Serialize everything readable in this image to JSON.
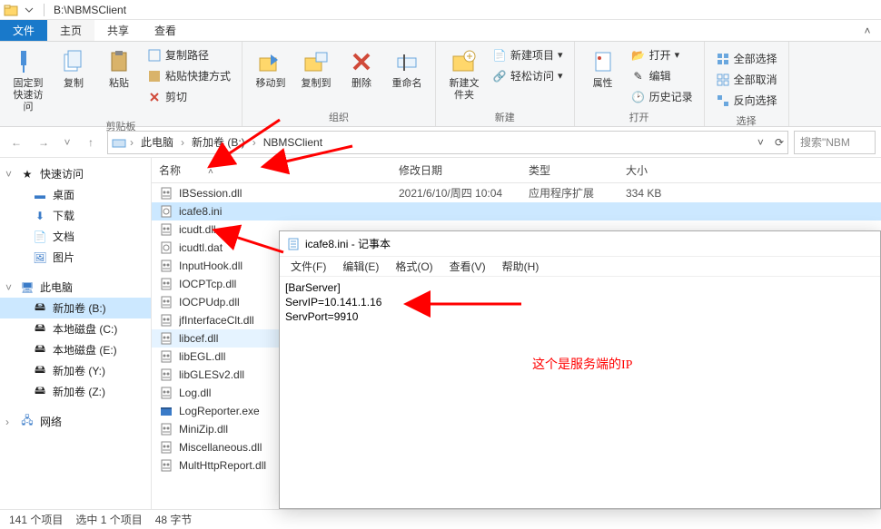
{
  "titlebar": {
    "path": "B:\\NBMSClient"
  },
  "tabs": {
    "file": "文件",
    "home": "主页",
    "share": "共享",
    "view": "查看"
  },
  "ribbon": {
    "pin": "固定到快速访问",
    "copy": "复制",
    "paste": "粘贴",
    "copypath": "复制路径",
    "pasteshortcut": "粘贴快捷方式",
    "cut": "剪切",
    "moveto": "移动到",
    "copyto": "复制到",
    "delete": "删除",
    "rename": "重命名",
    "newfolder": "新建文件夹",
    "newitem": "新建项目",
    "easyaccess": "轻松访问",
    "properties": "属性",
    "open": "打开",
    "edit": "编辑",
    "history": "历史记录",
    "selectall": "全部选择",
    "selectnone": "全部取消",
    "invert": "反向选择",
    "g_clipboard": "剪贴板",
    "g_organize": "组织",
    "g_new": "新建",
    "g_open": "打开",
    "g_select": "选择"
  },
  "breadcrumb": {
    "pc": "此电脑",
    "vol": "新加卷 (B:)",
    "folder": "NBMSClient"
  },
  "search": {
    "placeholder": "搜索\"NBM"
  },
  "columns": {
    "name": "名称",
    "date": "修改日期",
    "type": "类型",
    "size": "大小"
  },
  "nav": {
    "quick": "快速访问",
    "desktop": "桌面",
    "downloads": "下载",
    "documents": "文档",
    "pictures": "图片",
    "thispc": "此电脑",
    "volb": "新加卷 (B:)",
    "volc": "本地磁盘 (C:)",
    "vole": "本地磁盘 (E:)",
    "voly": "新加卷 (Y:)",
    "volz": "新加卷 (Z:)",
    "network": "网络"
  },
  "files": [
    {
      "name": "IBSession.dll",
      "date": "2021/6/10/周四 10:04",
      "type": "应用程序扩展",
      "size": "334 KB",
      "icon": "dll"
    },
    {
      "name": "icafe8.ini",
      "icon": "ini",
      "sel": true
    },
    {
      "name": "icudt.dll",
      "icon": "dll"
    },
    {
      "name": "icudtl.dat",
      "icon": "dat"
    },
    {
      "name": "InputHook.dll",
      "icon": "dll"
    },
    {
      "name": "IOCPTcp.dll",
      "icon": "dll"
    },
    {
      "name": "IOCPUdp.dll",
      "icon": "dll"
    },
    {
      "name": "jfInterfaceClt.dll",
      "icon": "dll"
    },
    {
      "name": "libcef.dll",
      "icon": "dll",
      "hl": true
    },
    {
      "name": "libEGL.dll",
      "icon": "dll"
    },
    {
      "name": "libGLESv2.dll",
      "icon": "dll"
    },
    {
      "name": "Log.dll",
      "icon": "dll"
    },
    {
      "name": "LogReporter.exe",
      "icon": "exe"
    },
    {
      "name": "MiniZip.dll",
      "icon": "dll"
    },
    {
      "name": "Miscellaneous.dll",
      "icon": "dll"
    },
    {
      "name": "MultHttpReport.dll",
      "icon": "dll"
    }
  ],
  "status": {
    "count": "141 个项目",
    "sel": "选中 1 个项目",
    "size": "48 字节"
  },
  "notepad": {
    "title": "icafe8.ini - 记事本",
    "menu": {
      "file": "文件(F)",
      "edit": "编辑(E)",
      "format": "格式(O)",
      "view": "查看(V)",
      "help": "帮助(H)"
    },
    "line1": "[BarServer]",
    "line2": "ServIP=10.141.1.16",
    "line3": "ServPort=9910",
    "annotation": "这个是服务端的IP"
  }
}
